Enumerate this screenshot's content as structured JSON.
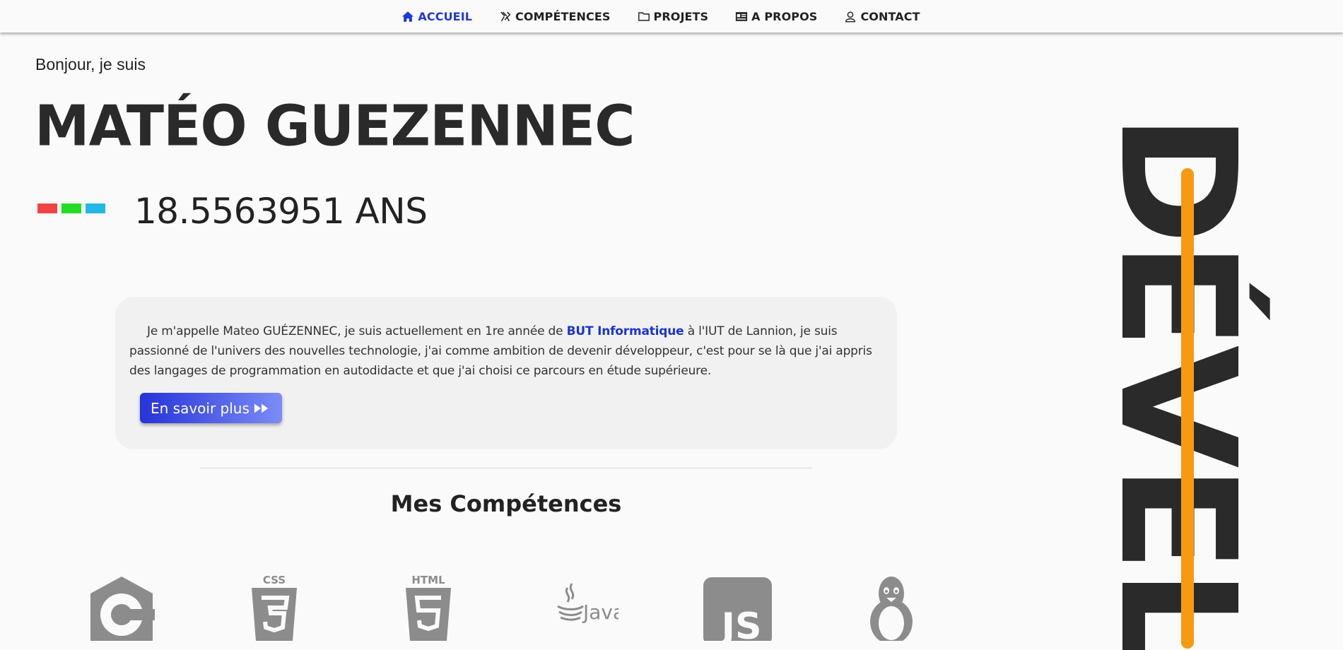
{
  "nav": {
    "items": [
      {
        "label": "ACCUEIL",
        "icon": "home-icon",
        "active": true
      },
      {
        "label": "COMPÉTENCES",
        "icon": "tools-icon",
        "active": false
      },
      {
        "label": "PROJETS",
        "icon": "folder-icon",
        "active": false
      },
      {
        "label": "A PROPOS",
        "icon": "id-card-icon",
        "active": false
      },
      {
        "label": "CONTACT",
        "icon": "user-icon",
        "active": false
      }
    ]
  },
  "hero": {
    "greeting": "Bonjour, je suis",
    "name": "MATÉO GUEZENNEC",
    "age": "18.5563951 ANS",
    "dot_colors": [
      "#f04444",
      "#22dd22",
      "#22b8e8"
    ]
  },
  "intro": {
    "text_before": "Je m'appelle Mateo GUÉZENNEC, je suis actuellement en 1re année de ",
    "highlight": "BUT Informatique",
    "text_after": " à l'IUT de Lannion, je suis passionné de l'univers des nouvelles technologie, j'ai comme ambition de devenir développeur, c'est pour se là que j'ai appris des langages de programmation en autodidacte et que j'ai choisi ce parcours en étude supérieure.",
    "button_label": "En savoir plus"
  },
  "skills": {
    "title": "Mes Compétences",
    "icons": [
      "c-logo-icon",
      "css3-logo-icon",
      "html5-logo-icon",
      "java-logo-icon",
      "js-logo-icon",
      "linux-tux-icon"
    ],
    "css_label": "CSS",
    "html_label": "HTML",
    "java_label": "Java",
    "js_label": "JS"
  },
  "side": {
    "vertical_text": "DÉVEL",
    "accent_color": "#f49b12"
  }
}
